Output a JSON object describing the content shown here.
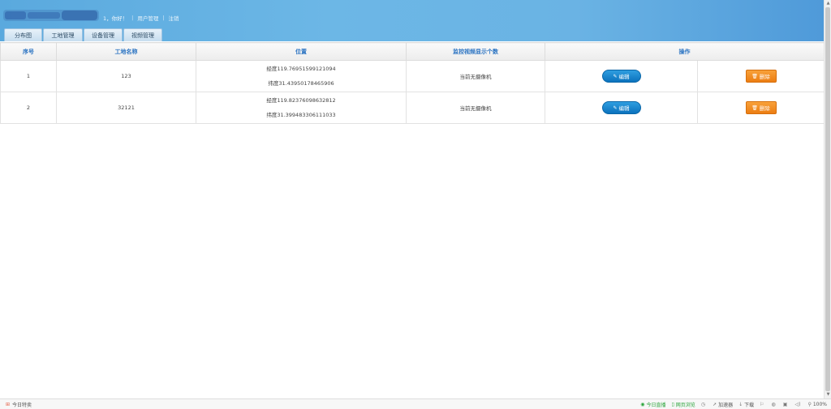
{
  "header": {
    "greeting": "1，你好！",
    "user_management": "用户管理",
    "logout": "注销",
    "tabs": [
      "分布图",
      "工地管理",
      "设备管理",
      "视频管理"
    ]
  },
  "table": {
    "headers": {
      "index": "序号",
      "site_name": "工地名称",
      "location": "位置",
      "camera_count": "监控视频显示个数",
      "actions": "操作"
    },
    "rows": [
      {
        "index": "1",
        "site_name": "123",
        "longitude": "经度119.76951599121094",
        "latitude": "纬度31.43950178465906",
        "camera_status": "当前无摄像机",
        "edit_label": "编辑",
        "delete_label": "删除"
      },
      {
        "index": "2",
        "site_name": "32121",
        "longitude": "经度119.82376098632812",
        "latitude": "纬度31.399483306111033",
        "camera_status": "当前无摄像机",
        "edit_label": "编辑",
        "delete_label": "删除"
      }
    ]
  },
  "statusbar": {
    "left_label": "今日特卖",
    "live": "今日直播",
    "eye_mode": "网页浏览",
    "accelerator": "加速器",
    "download": "下载",
    "zoom": "100%"
  },
  "colors": {
    "header_blue": "#6cb7e6",
    "header_text": "#2a73c2",
    "edit_button": "#1a86cf",
    "delete_button": "#f29024"
  }
}
